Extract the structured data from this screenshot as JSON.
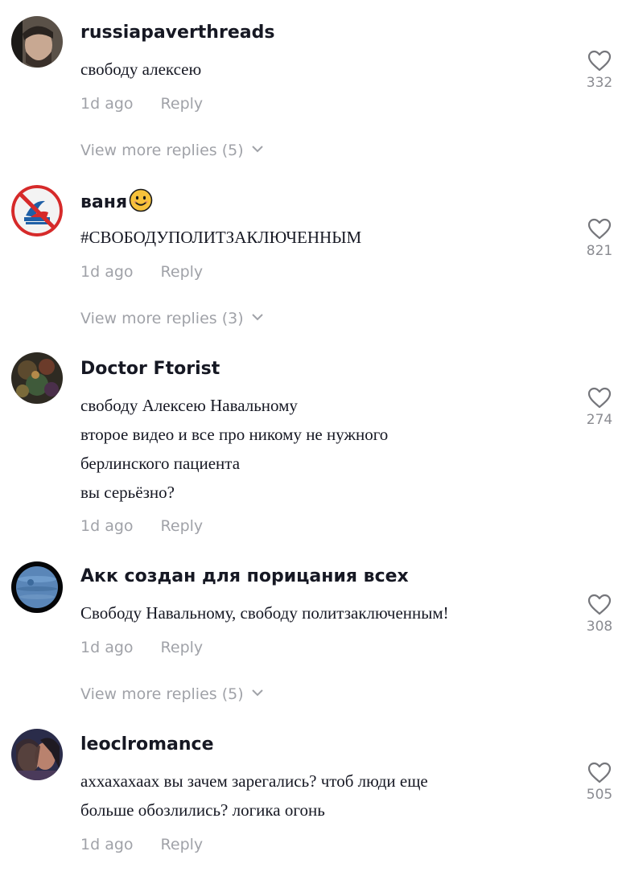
{
  "comments": [
    {
      "username": "russiapaverthreads",
      "lines": [
        "свободу алексею"
      ],
      "time": "1d ago",
      "reply_label": "Reply",
      "likes": "332",
      "more_replies": "View more replies (5)"
    },
    {
      "username": "ваня",
      "lines": [
        "#СВОБОДУПОЛИТЗАКЛЮЧЕННЫМ"
      ],
      "time": "1d ago",
      "reply_label": "Reply",
      "likes": "821",
      "more_replies": "View more replies (3)"
    },
    {
      "username": "Doctor Ftorist",
      "lines": [
        "свободу Алексею Навальному",
        "второе видео и все про никому не нужного",
        "берлинского пациента",
        "вы серьёзно?"
      ],
      "time": "1d ago",
      "reply_label": "Reply",
      "likes": "274"
    },
    {
      "username": "Акк создан для порицания всех",
      "lines": [
        "Свободу Навальному, свободу политзаключенным!"
      ],
      "time": "1d ago",
      "reply_label": "Reply",
      "likes": "308",
      "more_replies": "View more replies (5)"
    },
    {
      "username": "leoclromance",
      "lines": [
        "аххахахаах вы зачем зарегались? чтоб люди еще",
        "больше обозлились? логика огонь"
      ],
      "time": "1d ago",
      "reply_label": "Reply",
      "likes": "505"
    }
  ],
  "icons": {
    "like": "heart-outline-icon",
    "expand": "chevron-down-icon",
    "username_emoji": "smiling-face-emoji"
  },
  "colors": {
    "text": "#161823",
    "secondary": "#a0a2a8",
    "like_count": "#8a8b91",
    "emoji": "#f7c23b"
  }
}
